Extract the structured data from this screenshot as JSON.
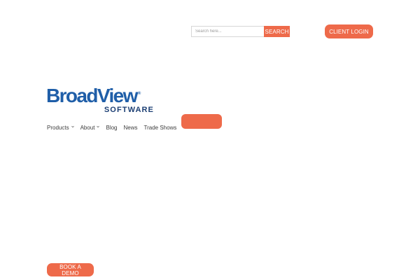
{
  "search": {
    "placeholder": "Search here...",
    "button_label": "SEARCH"
  },
  "header": {
    "client_login_label": "CLIENT LOGIN"
  },
  "logo": {
    "word": "BroadView",
    "reg_mark": "®",
    "sub": "SOFTWARE"
  },
  "nav": {
    "items": [
      {
        "label": "Products",
        "has_dropdown": true
      },
      {
        "label": "About",
        "has_dropdown": true
      },
      {
        "label": "Blog",
        "has_dropdown": false
      },
      {
        "label": "News",
        "has_dropdown": false
      },
      {
        "label": "Trade Shows",
        "has_dropdown": false
      }
    ]
  },
  "cta": {
    "book_demo_label": "BOOK A DEMO"
  },
  "colors": {
    "accent": "#ee6a4a",
    "brand_blue": "#1f5ea8",
    "brand_navy": "#1b3e73",
    "nav_text": "#3d3d3d"
  }
}
